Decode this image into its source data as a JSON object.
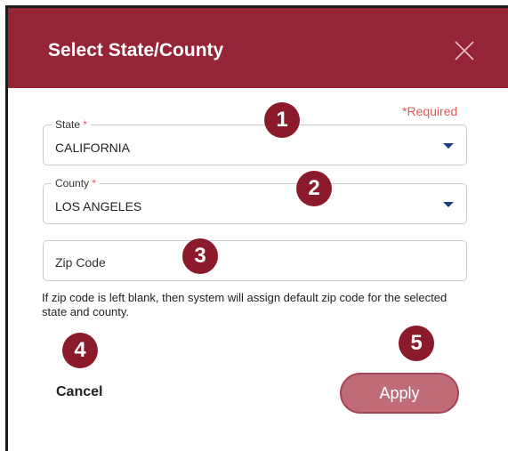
{
  "dialog": {
    "title": "Select State/County",
    "close_icon": "close-icon",
    "required_note": "*Required"
  },
  "state_field": {
    "label": "State",
    "required_mark": "*",
    "value": "CALIFORNIA"
  },
  "county_field": {
    "label": "County",
    "required_mark": "*",
    "value": "LOS ANGELES"
  },
  "zip_field": {
    "placeholder": "Zip Code"
  },
  "hint_text": "If zip code is left blank, then system will assign default zip code for the selected state and county.",
  "actions": {
    "cancel_label": "Cancel",
    "apply_label": "Apply"
  },
  "markers": [
    "1",
    "2",
    "3",
    "4",
    "5"
  ],
  "colors": {
    "header": "#952437",
    "marker": "#8b1a2a",
    "apply_button": "#c06b78",
    "required": "#e05a5a",
    "caret": "#1a3e7a"
  }
}
